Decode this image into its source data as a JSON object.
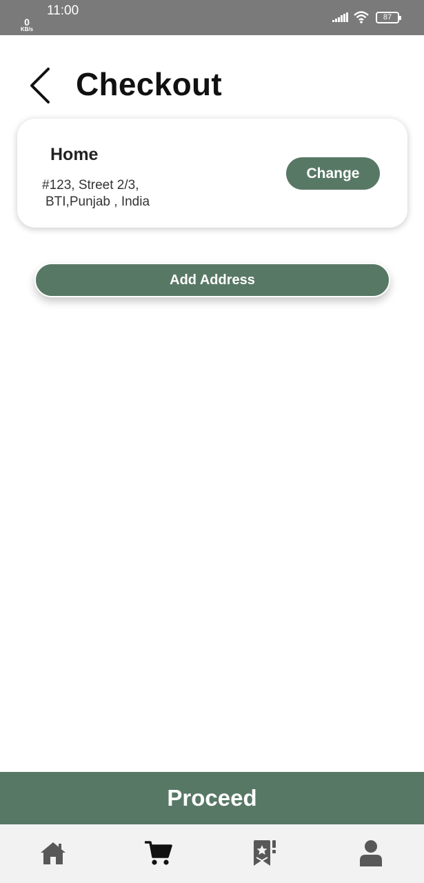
{
  "status_bar": {
    "time": "11:00",
    "net_speed": "0",
    "net_unit": "KB/s",
    "battery": "87"
  },
  "header": {
    "title": "Checkout",
    "back_icon": "chevron-left-icon"
  },
  "address_card": {
    "label": "Home",
    "line1": "#123, Street 2/3,",
    "line2": "BTI,Punjab , India",
    "change_label": "Change"
  },
  "add_address_label": "Add Address",
  "proceed_label": "Proceed",
  "bottom_nav": {
    "items": [
      {
        "icon": "home-icon",
        "active": false
      },
      {
        "icon": "cart-icon",
        "active": true
      },
      {
        "icon": "bookmark-star-icon",
        "active": false
      },
      {
        "icon": "profile-icon",
        "active": false
      }
    ]
  },
  "colors": {
    "accent": "#587866",
    "status_bar": "#7a7a7a",
    "nav_background": "#f2f2f2",
    "nav_icon_inactive": "#585858",
    "nav_icon_active": "#111111"
  }
}
